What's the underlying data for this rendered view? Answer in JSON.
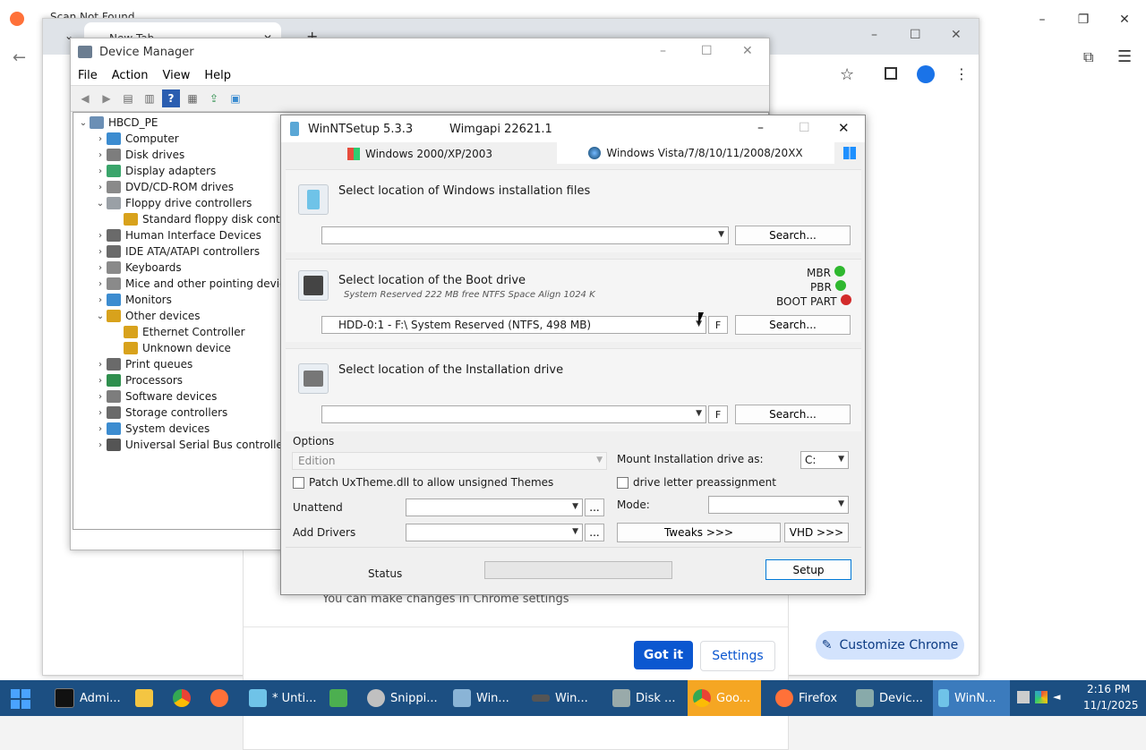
{
  "outer_chrome": {
    "tab_label": "Scan Not Found",
    "controls": {
      "minimize": "–",
      "restore": "❐",
      "close": "✕"
    }
  },
  "inner_chrome": {
    "tab_label": "New Tab",
    "new_tab": "+",
    "notification": {
      "text": "You can make changes in Chrome settings",
      "got_it": "Got it",
      "settings": "Settings"
    },
    "customize_button": "Customize Chrome"
  },
  "device_manager": {
    "title": "Device Manager",
    "menu": [
      "File",
      "Action",
      "View",
      "Help"
    ],
    "tree": [
      {
        "label": "HBCD_PE",
        "level": 0,
        "expander": "expanded",
        "icon": "computer-root-icon",
        "color": "#6b8fb5"
      },
      {
        "label": "Computer",
        "level": 1,
        "expander": "collapsed",
        "icon": "monitor-icon",
        "color": "#3c8cd0"
      },
      {
        "label": "Disk drives",
        "level": 1,
        "expander": "collapsed",
        "icon": "disk-icon",
        "color": "#7d7d7d"
      },
      {
        "label": "Display adapters",
        "level": 1,
        "expander": "collapsed",
        "icon": "display-adapter-icon",
        "color": "#3aa56b"
      },
      {
        "label": "DVD/CD-ROM drives",
        "level": 1,
        "expander": "collapsed",
        "icon": "dvd-icon",
        "color": "#8a8a8a"
      },
      {
        "label": "Floppy drive controllers",
        "level": 1,
        "expander": "expanded",
        "icon": "controller-icon",
        "color": "#9aa0a6"
      },
      {
        "label": "Standard floppy disk controller",
        "level": 2,
        "expander": "none",
        "icon": "warning-device-icon",
        "color": "#d8a21c"
      },
      {
        "label": "Human Interface Devices",
        "level": 1,
        "expander": "collapsed",
        "icon": "hid-icon",
        "color": "#6a6a6a"
      },
      {
        "label": "IDE ATA/ATAPI controllers",
        "level": 1,
        "expander": "collapsed",
        "icon": "ide-icon",
        "color": "#6a6a6a"
      },
      {
        "label": "Keyboards",
        "level": 1,
        "expander": "collapsed",
        "icon": "keyboard-icon",
        "color": "#8a8a8a"
      },
      {
        "label": "Mice and other pointing devices",
        "level": 1,
        "expander": "collapsed",
        "icon": "mouse-icon",
        "color": "#8a8a8a"
      },
      {
        "label": "Monitors",
        "level": 1,
        "expander": "collapsed",
        "icon": "monitor-icon",
        "color": "#3c8cd0"
      },
      {
        "label": "Other devices",
        "level": 1,
        "expander": "expanded",
        "icon": "other-device-icon",
        "color": "#d8a21c"
      },
      {
        "label": "Ethernet Controller",
        "level": 2,
        "expander": "none",
        "icon": "warning-device-icon",
        "color": "#d8a21c"
      },
      {
        "label": "Unknown device",
        "level": 2,
        "expander": "none",
        "icon": "warning-device-icon",
        "color": "#d8a21c"
      },
      {
        "label": "Print queues",
        "level": 1,
        "expander": "collapsed",
        "icon": "printer-icon",
        "color": "#6a6a6a"
      },
      {
        "label": "Processors",
        "level": 1,
        "expander": "collapsed",
        "icon": "processor-icon",
        "color": "#2f8f4e"
      },
      {
        "label": "Software devices",
        "level": 1,
        "expander": "collapsed",
        "icon": "software-device-icon",
        "color": "#7d7d7d"
      },
      {
        "label": "Storage controllers",
        "level": 1,
        "expander": "collapsed",
        "icon": "storage-icon",
        "color": "#6a6a6a"
      },
      {
        "label": "System devices",
        "level": 1,
        "expander": "collapsed",
        "icon": "system-icon",
        "color": "#3c8cd0"
      },
      {
        "label": "Universal Serial Bus controllers",
        "level": 1,
        "expander": "collapsed",
        "icon": "usb-icon",
        "color": "#555555"
      }
    ]
  },
  "winntsetup": {
    "title": "WinNTSetup 5.3.3",
    "wimgapi": "Wimgapi 22621.1",
    "tab_xp": "Windows 2000/XP/2003",
    "tab_vista": "Windows Vista/7/8/10/11/2008/20XX",
    "install_files": {
      "title": "Select location of Windows installation files",
      "value": "",
      "search": "Search..."
    },
    "boot_drive": {
      "title": "Select location of the Boot drive",
      "subtitle": "System Reserved 222 MB free NTFS Space Align 1024 K",
      "value": "HDD-0:1 - F:\\ System Reserved (NTFS, 498 MB)",
      "f": "F",
      "search": "Search...",
      "mbr": "MBR",
      "pbr": "PBR",
      "boot_part": "BOOT PART"
    },
    "install_drive": {
      "title": "Select location of the Installation drive",
      "value": "",
      "f": "F",
      "search": "Search..."
    },
    "options": {
      "label": "Options",
      "edition": "Edition",
      "mount_label": "Mount Installation drive as:",
      "mount_value": "C:",
      "patch_uxtheme": "Patch UxTheme.dll to allow unsigned Themes",
      "drive_letter": "drive letter preassignment",
      "unattend": "Unattend",
      "mode": "Mode:",
      "add_drivers": "Add Drivers",
      "ellipsis": "...",
      "tweaks": "Tweaks >>>",
      "vhd": "VHD >>>"
    },
    "status": "Status",
    "setup": "Setup"
  },
  "taskbar": {
    "items": [
      "Admi...",
      "* Unti...",
      "Snippi...",
      "Win...",
      "Win...",
      "Disk ...",
      "Goo...",
      "Firefox",
      "Devic...",
      "WinN..."
    ],
    "time": "2:16 PM",
    "date": "11/1/2025"
  },
  "colors": {
    "chrome_blue": "#0b57d0",
    "taskbar": "#1c4f82",
    "led_green": "#2fb82f",
    "led_red": "#d22b2b"
  }
}
